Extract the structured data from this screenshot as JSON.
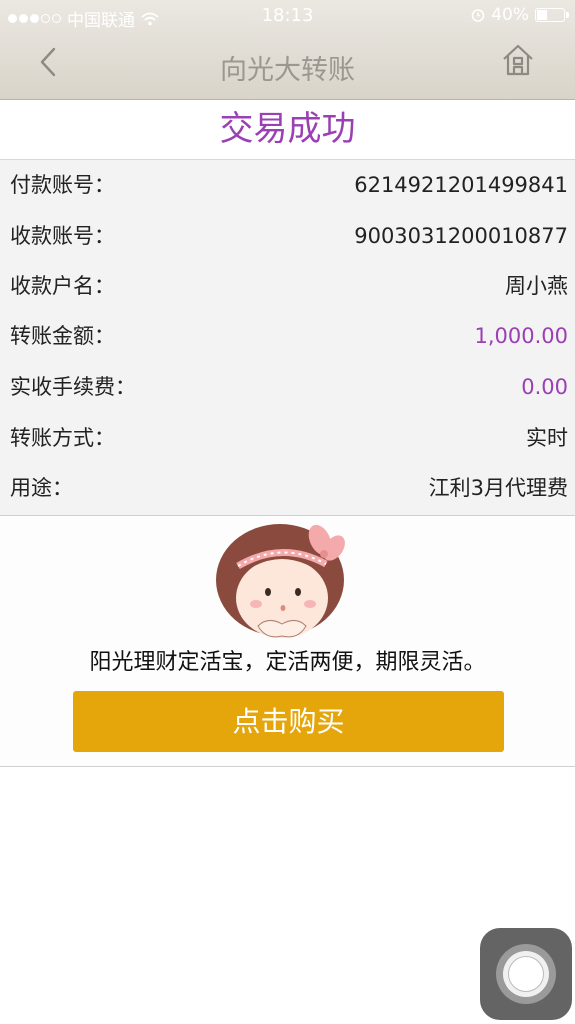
{
  "status_bar": {
    "carrier": "中国联通",
    "time": "18:13",
    "battery_text": "40%",
    "battery_level": 0.4
  },
  "nav": {
    "title": "向光大转账"
  },
  "result": {
    "title": "交易成功"
  },
  "details": [
    {
      "label": "付款账号：",
      "value": "6214921201499841"
    },
    {
      "label": "收款账号：",
      "value": "9003031200010877"
    },
    {
      "label": "收款户名：",
      "value": "周小燕"
    },
    {
      "label": "转账金额：",
      "value": "1,000.00"
    },
    {
      "label": "实收手续费：",
      "value": "0.00"
    },
    {
      "label": "转账方式：",
      "value": "实时"
    },
    {
      "label": "用途：",
      "value": "江利3月代理费"
    }
  ],
  "promo": {
    "slogan": "阳光理财定活宝，定活两便，期限灵活。",
    "button_label": "点击购买"
  },
  "colors": {
    "accent_purple": "#9a3fb4",
    "button_gold": "#e5a60c",
    "nav_bg": "#e2ded6"
  },
  "icons": {
    "back": "chevron-left-icon",
    "home": "home-icon",
    "assistive_touch": "assistive-touch-icon"
  }
}
